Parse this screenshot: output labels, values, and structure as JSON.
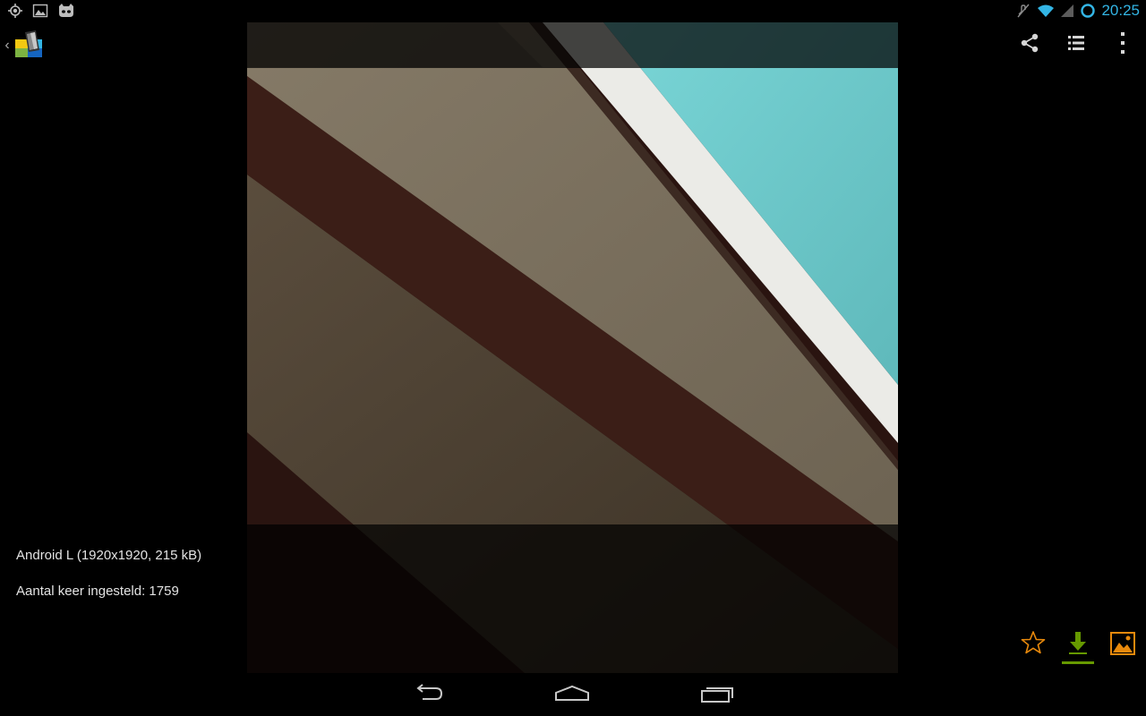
{
  "status_bar": {
    "time": "20:25",
    "left_icons": [
      "location-icon",
      "image-notification-icon",
      "cyanogenmod-icon"
    ],
    "right_icons": [
      "mute-icon",
      "wifi-icon",
      "signal-icon",
      "battery-ring-icon"
    ],
    "accent_color": "#33b5e5"
  },
  "action_bar": {
    "app_icon": "wallpaper-app-icon",
    "actions": [
      "share-icon",
      "list-icon",
      "overflow-menu-icon"
    ]
  },
  "wallpaper": {
    "name": "Android L",
    "colors": {
      "teal": "#6ecfd0",
      "white": "#ebebe7",
      "taupe": "#7a6f5e",
      "maroon": "#3a1d17",
      "brown": "#4c4032"
    }
  },
  "info": {
    "title_line": "Android L (1920x1920, 215 kB)",
    "count_line": "Aantal keer ingesteld: 1759"
  },
  "bottom_actions": {
    "favorite": "star-icon",
    "download": "download-icon",
    "set_wallpaper": "set-wallpaper-icon",
    "download_color": "#669900",
    "accent_orange": "#e8890c"
  },
  "nav_bar": {
    "buttons": [
      "back-icon",
      "home-icon",
      "recents-icon"
    ]
  }
}
